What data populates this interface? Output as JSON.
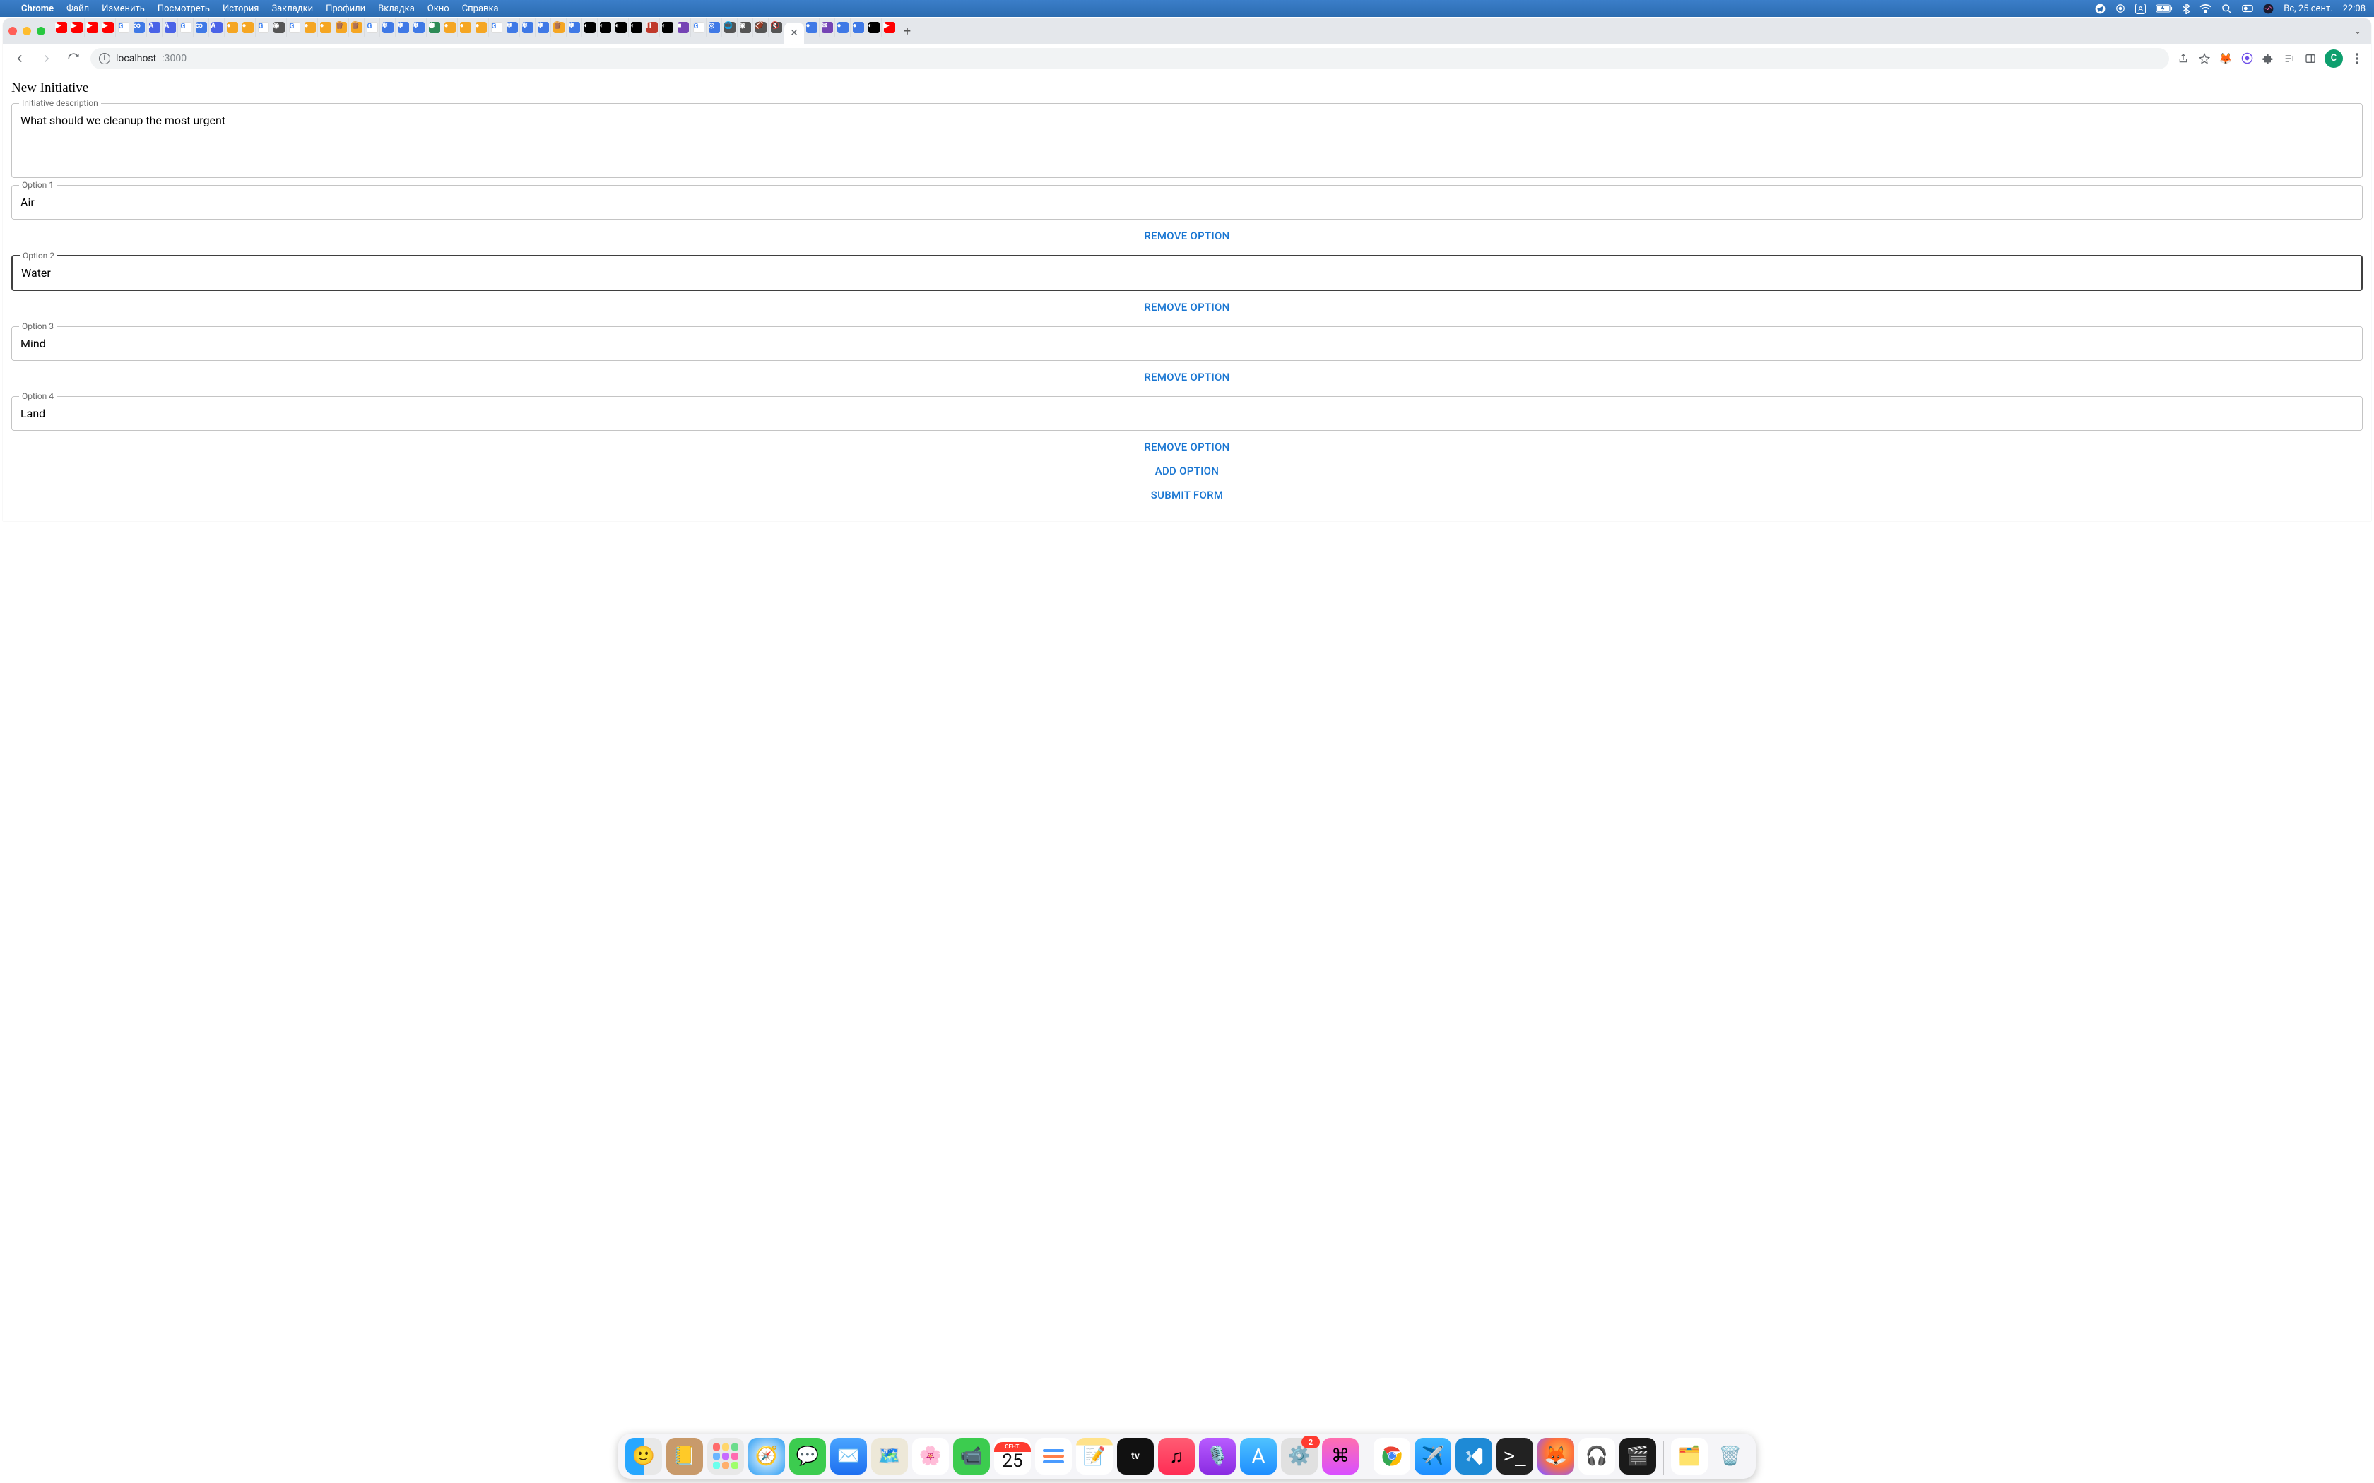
{
  "menubar": {
    "app_name": "Chrome",
    "items": [
      "Файл",
      "Изменить",
      "Посмотреть",
      "История",
      "Закладки",
      "Профили",
      "Вкладка",
      "Окно",
      "Справка"
    ],
    "right": {
      "date": "Вс, 25 сент.",
      "time": "22:08",
      "input_indicator": "A"
    }
  },
  "chrome": {
    "url_host": "localhost",
    "url_path": ":3000",
    "profile_initial": "C"
  },
  "page": {
    "title": "New Initiative",
    "description": {
      "label": "Initiative description",
      "value": "What should we cleanup the most urgent"
    },
    "options": [
      {
        "label": "Option 1",
        "value": "Air",
        "focused": false
      },
      {
        "label": "Option 2",
        "value": "Water",
        "focused": true
      },
      {
        "label": "Option 3",
        "value": "Mind",
        "focused": false
      },
      {
        "label": "Option 4",
        "value": "Land",
        "focused": false
      }
    ],
    "buttons": {
      "remove_option": "REMOVE OPTION",
      "add_option": "ADD OPTION",
      "submit_form": "SUBMIT FORM"
    }
  },
  "dock": {
    "calendar_month": "СЕНТ.",
    "calendar_day": "25",
    "settings_badge": "2"
  }
}
